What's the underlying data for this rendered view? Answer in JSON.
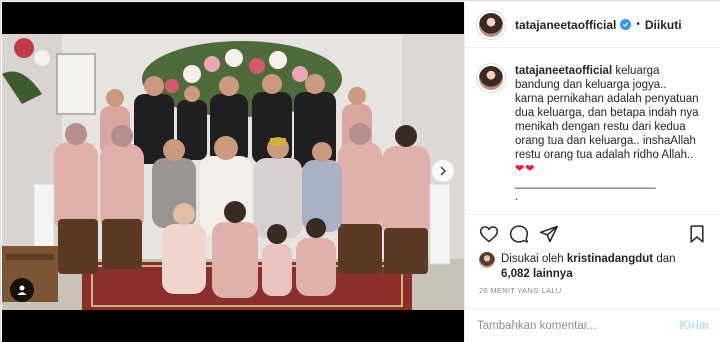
{
  "post": {
    "username": "tatajaneetaofficial",
    "follow_status": "Diikuti",
    "separator": "•"
  },
  "caption": {
    "username": "tatajaneetaofficial",
    "lines": [
      "keluarga",
      "bandung dan keluarga jogya..",
      "karna pernikahan adalah penyatuan",
      "dua keluarga, dan betapa indah nya",
      "menikah dengan restu dari kedua",
      "orang tua dan keluarga.. inshaAllah",
      "restu orang tua adalah ridho Allah.."
    ],
    "hearts": "❤❤",
    "underline": "______________________",
    "end": "."
  },
  "likes": {
    "prefix": "Disukai oleh",
    "user": "kristinadangdut",
    "and": "dan",
    "others": "6,082 lainnya"
  },
  "timestamp": "26 MENIT YANG LALU",
  "comment": {
    "placeholder": "Tambahkan komentar...",
    "send_label": "Kirim"
  },
  "colors": {
    "verified": "#3897f0",
    "send": "#b2dffc",
    "heart": "#ed1a3a"
  },
  "icons": [
    "heart-icon",
    "comment-icon",
    "share-icon",
    "bookmark-icon",
    "verified-icon",
    "chevron-right-icon",
    "user-tag-icon"
  ]
}
